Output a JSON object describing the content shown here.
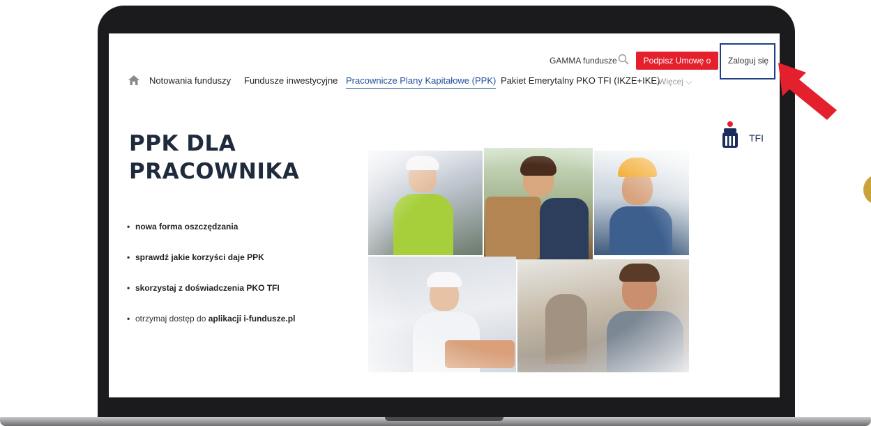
{
  "topbar": {
    "gamma_label": "GAMMA fundusze",
    "sign_label": "Podpisz Umowę o PPK",
    "login_label": "Zaloguj się"
  },
  "nav": {
    "items": [
      "Notowania funduszy",
      "Fundusze inwestycyjne",
      "Pracownicze Plany Kapitałowe (PPK)",
      "Pakiet Emerytalny PKO TFI (IKZE+IKE)"
    ],
    "active_index": 2,
    "more_label": "Więcej ⌵"
  },
  "hero": {
    "title_line1": "PPK DLA",
    "title_line2": "PRACOWNIKA"
  },
  "bullets": {
    "b1": "nowa forma oszczędzania",
    "b2": "sprawdź jakie korzyści daje PPK",
    "b3": "skorzystaj z doświadczenia PKO TFI",
    "b4_prefix": "otrzymaj dostęp do ",
    "b4_bold": "aplikacji i-fundusze.pl"
  },
  "logo": {
    "text": "TFI"
  },
  "colors": {
    "brand_red": "#e4202d",
    "nav_active": "#1f4f9c",
    "highlight_box": "#1f3f8a",
    "logo_navy": "#1a2d5a"
  }
}
